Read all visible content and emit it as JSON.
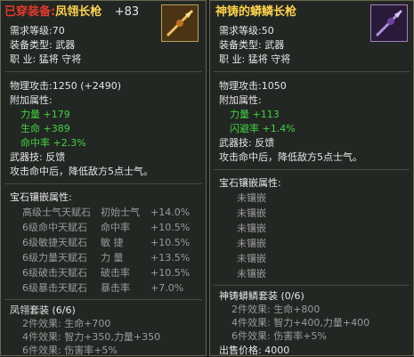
{
  "left": {
    "equipped_tag": "已穿装备:",
    "item_name": "凤翎长枪",
    "upgrade": "+83",
    "level_req": "需求等级:70",
    "equip_type": "装备类型:  武器",
    "class_line": "职    业:  猛将  守将",
    "phys_attack": "物理攻击:1250 (+2490)",
    "attr_header": "附加属性:",
    "attrs": [
      {
        "name": "力量",
        "value": "+179"
      },
      {
        "name": "生命",
        "value": "+389"
      },
      {
        "name": "命中率",
        "value": "+2.3%"
      }
    ],
    "skill": "武器技: 反馈",
    "skill_desc": "攻击命中后，降低敌方5点士气。",
    "gem_header": "宝石镶嵌属性:",
    "gems": [
      {
        "gem": "高级士气天赋石",
        "stat": "初始士气",
        "value": "+14.0%"
      },
      {
        "gem": "6级命中天赋石",
        "stat": "命中率",
        "value": "+10.5%"
      },
      {
        "gem": "6级敏捷天赋石",
        "stat": "敏  捷",
        "value": "+10.5%"
      },
      {
        "gem": "6级力量天赋石",
        "stat": "力  量",
        "value": "+13.5%"
      },
      {
        "gem": "6级破击天赋石",
        "stat": "破击率",
        "value": "+10.5%"
      },
      {
        "gem": "6级暴击天赋石",
        "stat": "暴击率",
        "value": "+7.0%"
      }
    ],
    "set_header": "凤翎套装 (6/6)",
    "set_effects": [
      "2件效果: 生命+700",
      "4件效果: 智力+350,力量+350",
      "6件效果: 伤害率+5%"
    ]
  },
  "right": {
    "item_name": "神铸的蟒鳞长枪",
    "level_req": "需求等级:50",
    "equip_type": "装备类型:  武器",
    "class_line": "职    业:  猛将  守将",
    "phys_attack": "物理攻击:1050",
    "attr_header": "附加属性:",
    "attrs": [
      {
        "name": "力量",
        "value": "+113"
      },
      {
        "name": "闪避率",
        "value": "+1.4%"
      }
    ],
    "skill": "武器技: 反馈",
    "skill_desc": "攻击命中后，降低敌方5点士气。",
    "gem_header": "宝石镶嵌属性:",
    "gem_slots": [
      "未镶嵌",
      "未镶嵌",
      "未镶嵌",
      "未镶嵌",
      "未镶嵌",
      "未镶嵌"
    ],
    "set_header": "神铸蟒鳞套装 (0/6)",
    "set_effects": [
      "2件效果: 生命+800",
      "4件效果: 智力+400,力量+400",
      "6件效果: 伤害率+5%"
    ],
    "price": "出售价格: 4000"
  },
  "colors": {
    "gold": "#ffd24a",
    "green": "#41d241",
    "grey": "#9a9a9a",
    "red": "#e23a2a"
  }
}
